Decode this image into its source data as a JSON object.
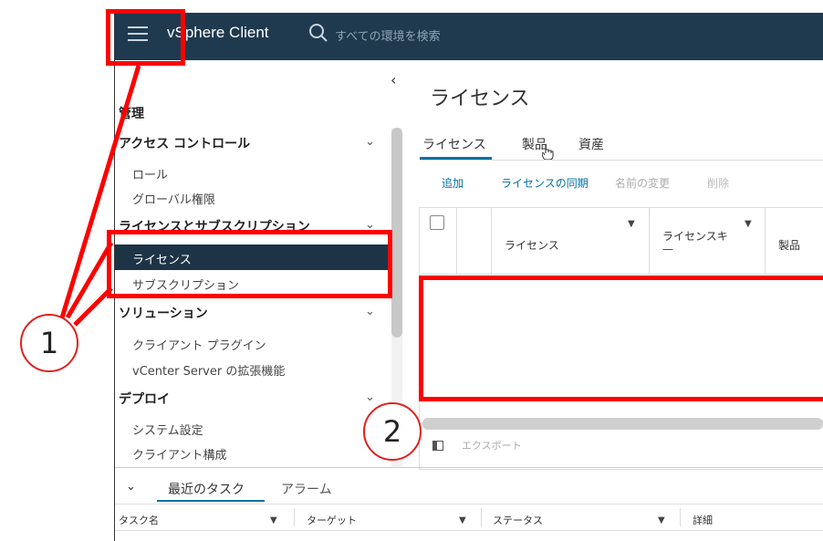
{
  "header": {
    "app_title": "vSphere Client",
    "search_placeholder": "すべての環境を検索"
  },
  "sidebar": {
    "heading": "管理",
    "sections": [
      {
        "label": "アクセス コントロール",
        "items": [
          "ロール",
          "グローバル権限"
        ]
      },
      {
        "label": "ライセンスとサブスクリプション",
        "items": [
          "ライセンス",
          "サブスクリプション"
        ],
        "selected": "ライセンス"
      },
      {
        "label": "ソリューション",
        "items": [
          "クライアント プラグイン",
          "vCenter Server の拡張機能"
        ]
      },
      {
        "label": "デプロイ",
        "items": [
          "システム設定",
          "クライアント構成"
        ]
      }
    ]
  },
  "main": {
    "title": "ライセンス",
    "tabs": [
      "ライセンス",
      "製品",
      "資産"
    ],
    "active_tab": "ライセンス",
    "actions": [
      {
        "label": "追加",
        "enabled": true
      },
      {
        "label": "ライセンスの同期",
        "enabled": true
      },
      {
        "label": "名前の変更",
        "enabled": false
      },
      {
        "label": "削除",
        "enabled": false
      }
    ],
    "columns": [
      "ライセンス",
      "ライセンスキ\n—",
      "製品"
    ],
    "export_label": "エクスポート"
  },
  "bottom_panel": {
    "tabs": [
      "最近のタスク",
      "アラーム"
    ],
    "columns": [
      "タスク名",
      "ターゲット",
      "ステータス",
      "詳細"
    ]
  },
  "annotations": {
    "marker_1": "1",
    "marker_2": "2",
    "color": "#ff0000"
  },
  "colors": {
    "topbar": "#1f3a4f",
    "accent": "#0072a3",
    "selected_bg": "#1d3446"
  }
}
